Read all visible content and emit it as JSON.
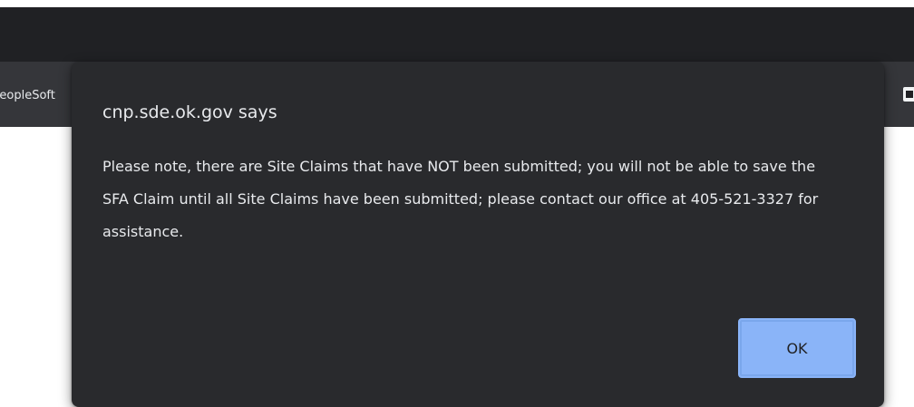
{
  "browser": {
    "bookmark_left_text": "PeopleSoft",
    "bookmark_right_icon": "bookmark-favicon-icon"
  },
  "dialog": {
    "title": "cnp.sde.ok.gov says",
    "message": "Please note, there are Site Claims that have NOT been submitted; you will not be able to save the SFA Claim until all Site Claims have been submitted; please contact our office at 405-521-3327 for assistance.",
    "ok_label": "OK"
  },
  "colors": {
    "titlebar": "#202124",
    "bookmarks_bar": "#35363a",
    "dialog_background": "#292a2d",
    "dialog_text": "#e8eaed",
    "ok_button": "#8ab4f8",
    "page_background": "#ffffff"
  }
}
